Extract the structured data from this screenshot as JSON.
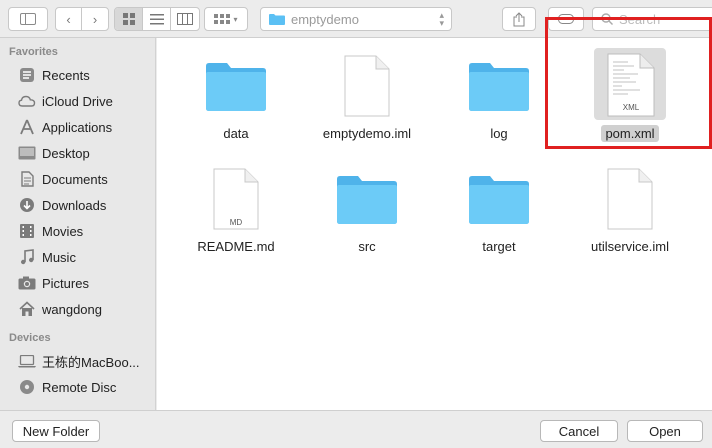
{
  "toolbar": {
    "path_folder": "emptydemo",
    "search_placeholder": "Search"
  },
  "sidebar": {
    "favorites_header": "Favorites",
    "favorites": [
      {
        "label": "Recents",
        "icon": "clock-icon"
      },
      {
        "label": "iCloud Drive",
        "icon": "cloud-icon"
      },
      {
        "label": "Applications",
        "icon": "applications-icon"
      },
      {
        "label": "Desktop",
        "icon": "desktop-icon"
      },
      {
        "label": "Documents",
        "icon": "documents-icon"
      },
      {
        "label": "Downloads",
        "icon": "downloads-icon"
      },
      {
        "label": "Movies",
        "icon": "movies-icon"
      },
      {
        "label": "Music",
        "icon": "music-icon"
      },
      {
        "label": "Pictures",
        "icon": "camera-icon"
      },
      {
        "label": "wangdong",
        "icon": "home-icon"
      }
    ],
    "devices_header": "Devices",
    "devices": [
      {
        "label": "王栋的MacBoo...",
        "icon": "laptop-icon"
      },
      {
        "label": "Remote Disc",
        "icon": "disc-icon"
      }
    ]
  },
  "files": [
    {
      "name": "data",
      "type": "folder"
    },
    {
      "name": "emptydemo.iml",
      "type": "document",
      "badge": ""
    },
    {
      "name": "log",
      "type": "folder"
    },
    {
      "name": "pom.xml",
      "type": "document",
      "badge": "XML",
      "selected": true
    },
    {
      "name": "README.md",
      "type": "document",
      "badge": "MD"
    },
    {
      "name": "src",
      "type": "folder"
    },
    {
      "name": "target",
      "type": "folder"
    },
    {
      "name": "utilservice.iml",
      "type": "document",
      "badge": ""
    }
  ],
  "bottom": {
    "new_folder": "New Folder",
    "cancel": "Cancel",
    "open": "Open"
  },
  "colors": {
    "folder": "#5bc0f4",
    "highlight": "#e02020"
  }
}
